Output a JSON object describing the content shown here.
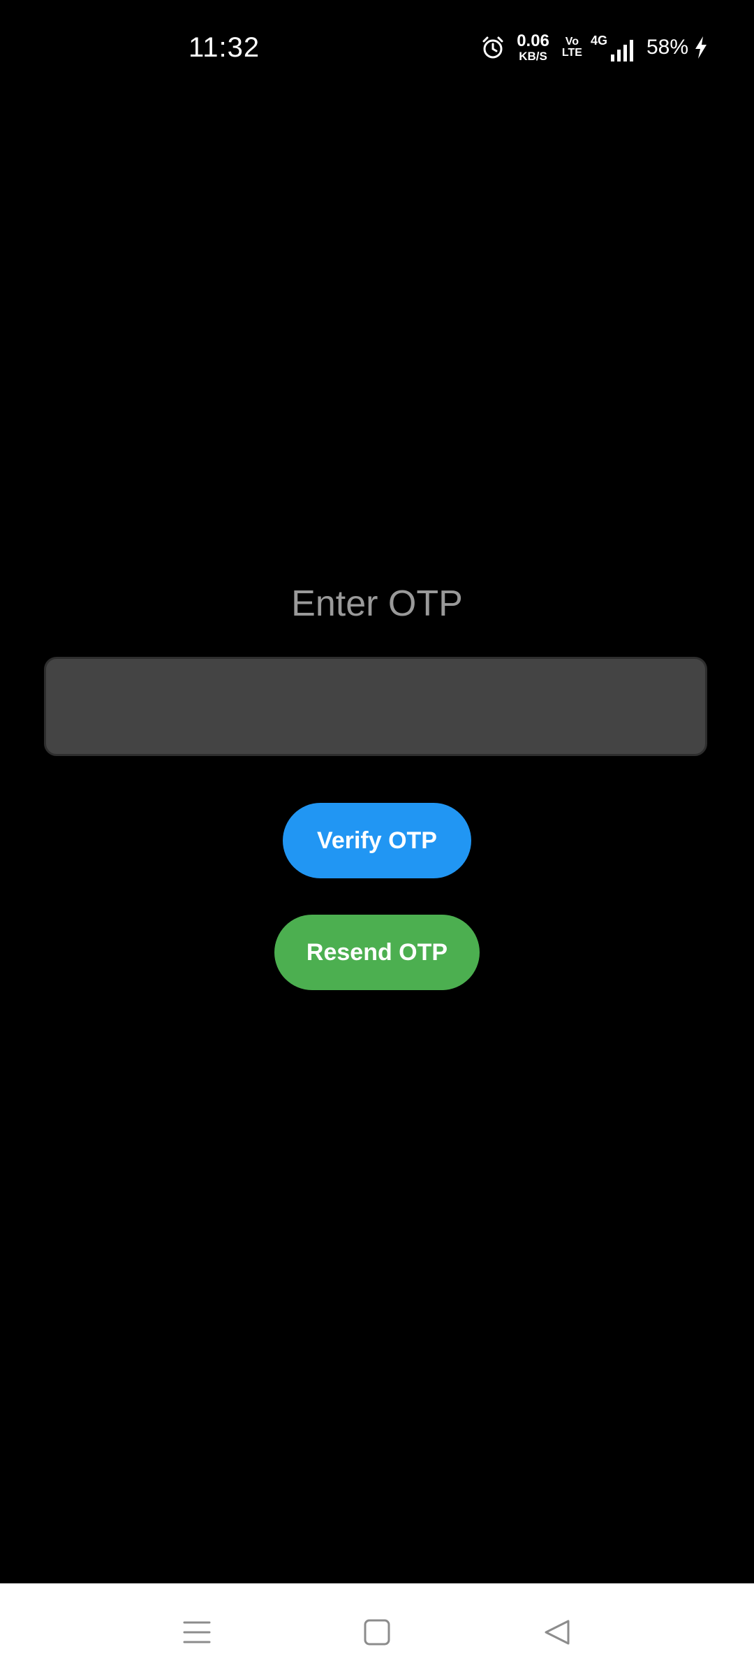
{
  "status_bar": {
    "time": "11:32",
    "net_speed_value": "0.06",
    "net_speed_unit": "KB/S",
    "volte_top": "Vo",
    "volte_bottom": "LTE",
    "network_type": "4G",
    "battery": "58%",
    "icons": [
      "alarm-icon",
      "signal-icon",
      "charging-icon"
    ]
  },
  "main": {
    "title": "Enter OTP",
    "otp_input": {
      "value": "",
      "placeholder": ""
    },
    "verify_button_label": "Verify OTP",
    "resend_button_label": "Resend OTP"
  },
  "colors": {
    "background": "#000000",
    "title": "#9a9a9a",
    "input_background": "#444444",
    "verify_button": "#2196F3",
    "resend_button": "#4CAF50",
    "nav_bar": "#ffffff",
    "nav_icon": "#8c8c8c"
  },
  "nav_bar": {
    "icons": [
      "menu-icon",
      "home-icon",
      "back-icon"
    ]
  }
}
